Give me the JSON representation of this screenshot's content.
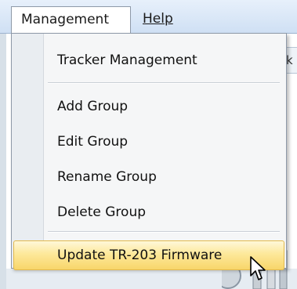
{
  "menubar": {
    "management_label": "Management",
    "help_label": "Help"
  },
  "background": {
    "partial_tab_text": "k"
  },
  "menu": {
    "items": [
      {
        "label": "Tracker Management"
      },
      {
        "label": "Add Group"
      },
      {
        "label": "Edit Group"
      },
      {
        "label": "Rename Group"
      },
      {
        "label": "Delete Group"
      },
      {
        "label": "Update TR-203 Firmware",
        "highlighted": true
      }
    ]
  },
  "colors": {
    "highlight": "#fde89a",
    "menubar": "#cfe0f4"
  },
  "icons": {
    "cursor": "mouse-pointer-icon"
  }
}
